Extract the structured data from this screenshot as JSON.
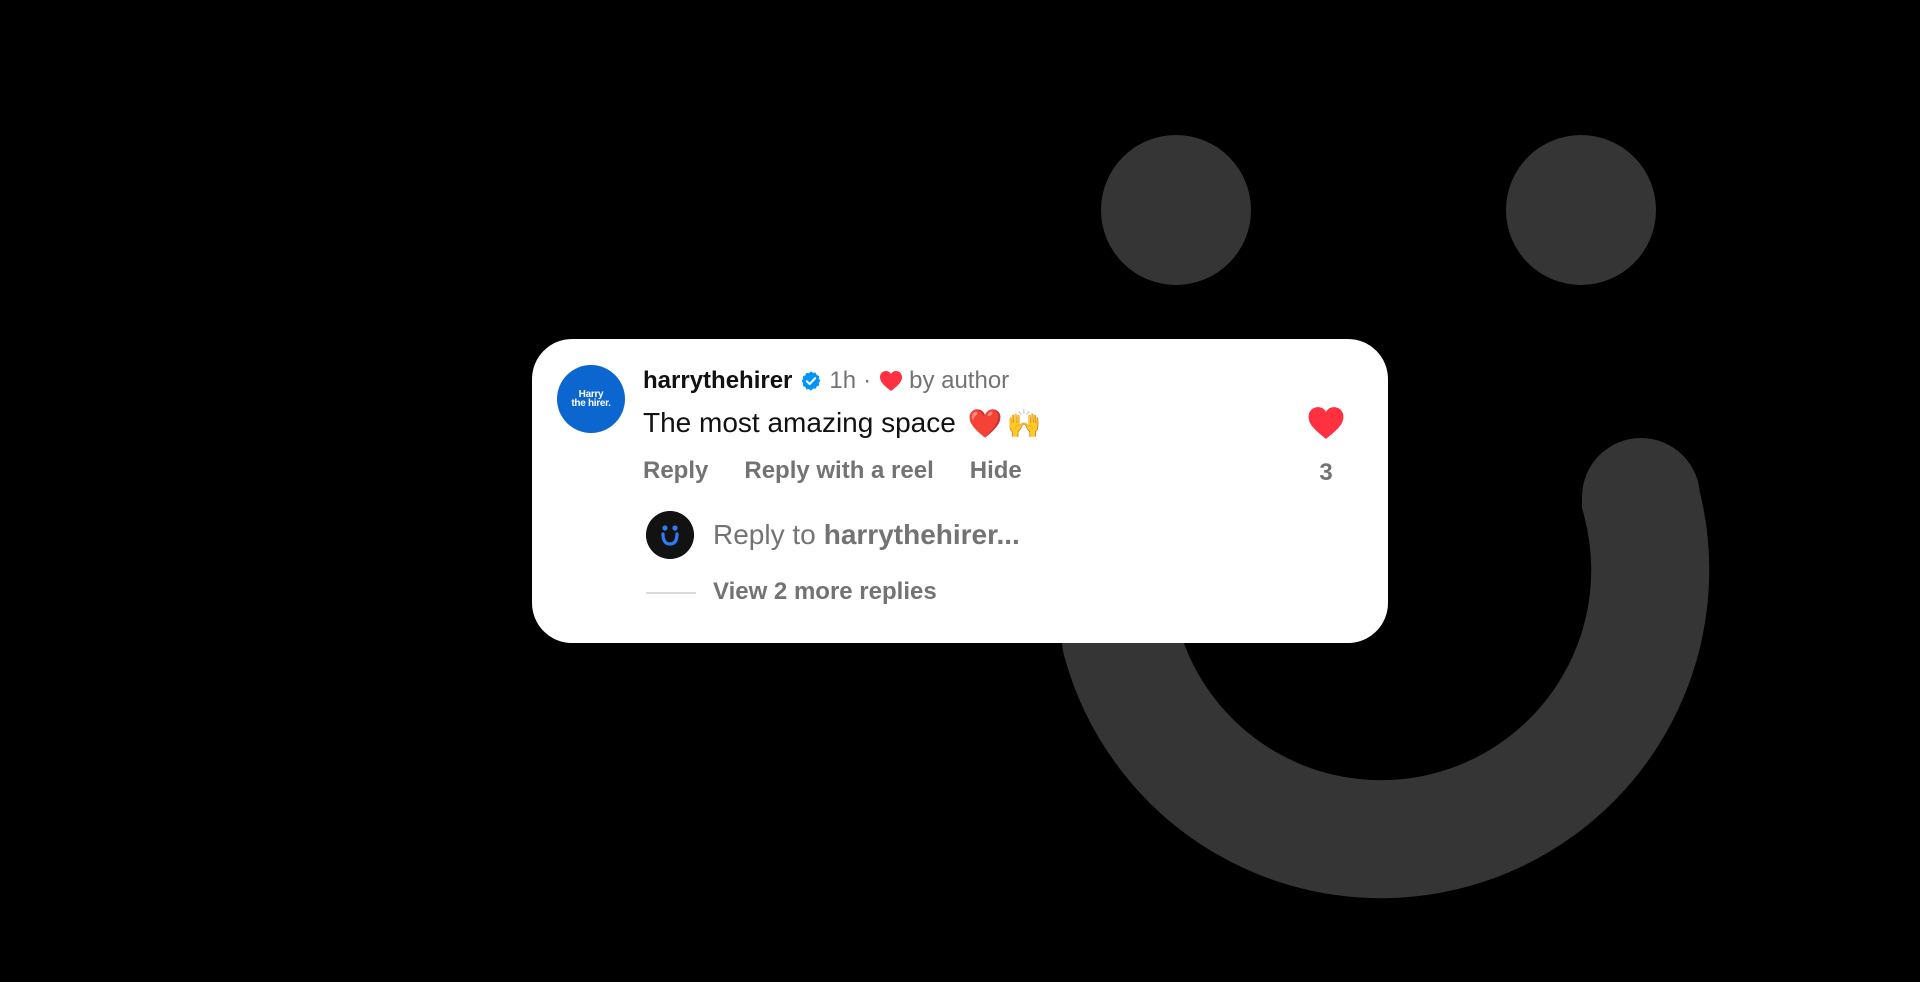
{
  "comment": {
    "avatar_text_line1": "Harry",
    "avatar_text_line2": "the hirer.",
    "username": "harrythehirer",
    "time": "1h",
    "separator": "·",
    "liked_by": "by author",
    "text": "The most amazing space",
    "emoji_1": "❤️",
    "emoji_2": "🙌",
    "like_count": "3"
  },
  "actions": {
    "reply": "Reply",
    "reply_with_reel": "Reply with a reel",
    "hide": "Hide"
  },
  "reply_box": {
    "prefix": "Reply to",
    "handle": "harrythehirer..."
  },
  "thread": {
    "view_more": "View 2 more replies"
  },
  "colors": {
    "background": "#000000",
    "smiley": "#353535",
    "card": "#ffffff",
    "avatar_brand": "#0b66d0",
    "verified": "#0095f6",
    "like_red": "#ff3040",
    "muted_text": "#737373",
    "reply_smile": "#2f7bf5"
  }
}
